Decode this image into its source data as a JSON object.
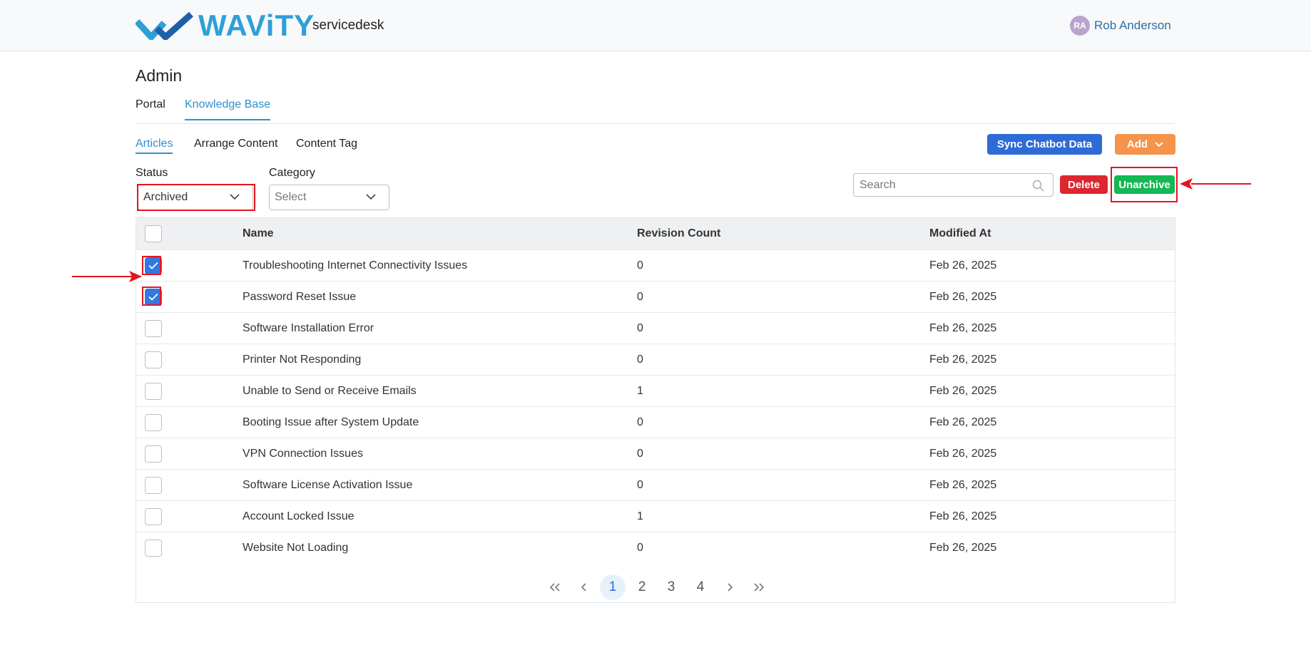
{
  "header": {
    "brand": "WAViTY",
    "app_name": "servicedesk",
    "user_initials": "RA",
    "user_name": "Rob Anderson"
  },
  "page_title": "Admin",
  "main_tabs": [
    {
      "label": "Portal",
      "active": false
    },
    {
      "label": "Knowledge Base",
      "active": true
    }
  ],
  "sub_tabs": [
    {
      "label": "Articles",
      "active": true
    },
    {
      "label": "Arrange Content",
      "active": false
    },
    {
      "label": "Content Tag",
      "active": false
    }
  ],
  "actions": {
    "sync_label": "Sync Chatbot Data",
    "add_label": "Add",
    "delete_label": "Delete",
    "unarchive_label": "Unarchive"
  },
  "filters": {
    "status_label": "Status",
    "status_value": "Archived",
    "category_label": "Category",
    "category_value": "Select"
  },
  "search": {
    "placeholder": "Search"
  },
  "table": {
    "columns": [
      "Name",
      "Revision Count",
      "Modified At"
    ],
    "rows": [
      {
        "name": "Troubleshooting Internet Connectivity Issues",
        "revisions": "0",
        "modified": "Feb 26, 2025",
        "checked": true
      },
      {
        "name": "Password Reset Issue",
        "revisions": "0",
        "modified": "Feb 26, 2025",
        "checked": true
      },
      {
        "name": "Software Installation Error",
        "revisions": "0",
        "modified": "Feb 26, 2025",
        "checked": false
      },
      {
        "name": "Printer Not Responding",
        "revisions": "0",
        "modified": "Feb 26, 2025",
        "checked": false
      },
      {
        "name": "Unable to Send or Receive Emails",
        "revisions": "1",
        "modified": "Feb 26, 2025",
        "checked": false
      },
      {
        "name": "Booting Issue after System Update",
        "revisions": "0",
        "modified": "Feb 26, 2025",
        "checked": false
      },
      {
        "name": "VPN Connection Issues",
        "revisions": "0",
        "modified": "Feb 26, 2025",
        "checked": false
      },
      {
        "name": "Software License Activation Issue",
        "revisions": "0",
        "modified": "Feb 26, 2025",
        "checked": false
      },
      {
        "name": "Account Locked Issue",
        "revisions": "1",
        "modified": "Feb 26, 2025",
        "checked": false
      },
      {
        "name": "Website Not Loading",
        "revisions": "0",
        "modified": "Feb 26, 2025",
        "checked": false
      }
    ]
  },
  "pagination": {
    "pages": [
      "1",
      "2",
      "3",
      "4"
    ],
    "current": "1",
    "first_icon": "double-chevron-left-icon",
    "prev_icon": "chevron-left-icon",
    "next_icon": "chevron-right-icon",
    "last_icon": "double-chevron-right-icon"
  },
  "colors": {
    "brand": "#2f9fd8",
    "primary": "#2f6bd6",
    "add": "#f5944a",
    "delete": "#dc2730",
    "unarchive": "#14b855",
    "annotation": "#e6141f"
  }
}
